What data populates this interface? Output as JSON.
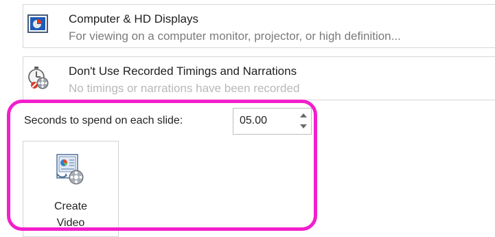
{
  "resolution_dropdown": {
    "title": "Computer & HD Displays",
    "description": "For viewing on a computer monitor, projector, or high definition...",
    "icon": "presentation-screen-icon"
  },
  "timings_dropdown": {
    "title": "Don't Use Recorded Timings and Narrations",
    "description": "No timings or narrations have been recorded",
    "icon": "stopwatch-film-icon"
  },
  "slide_timing": {
    "label": "Seconds to spend on each slide:",
    "value": "05.00"
  },
  "create_video_button": {
    "line1": "Create",
    "line2": "Video",
    "icon": "create-video-icon"
  },
  "colors": {
    "highlight": "#f21fcc"
  }
}
